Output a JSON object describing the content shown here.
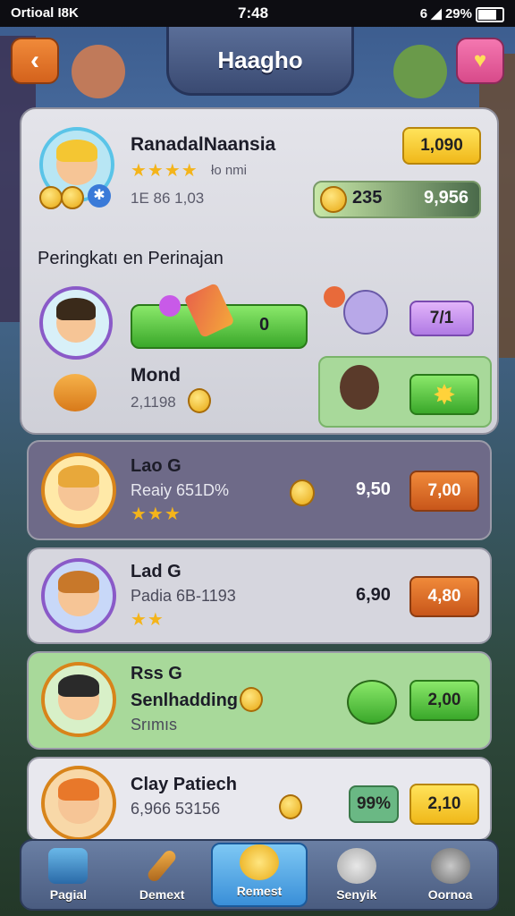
{
  "status_bar": {
    "left": "Ortioal I8K",
    "time": "7:48",
    "right": "6 ◢ 29%"
  },
  "header": {
    "title": "Haagho",
    "back_icon": "chevron-left-icon",
    "favorite_icon": "heart-icon"
  },
  "player": {
    "name": "RanadalNaansia",
    "stars_text": "★★★★",
    "rating_text": "ło nmi",
    "id_text": "1E 86 1,03",
    "gold_value": "1,090",
    "coin_value": "235",
    "total_value": "9,956"
  },
  "section": {
    "title": "Peringkatı en Perinajan"
  },
  "match": {
    "progress_value": "0",
    "badge_value": "7/1",
    "opponent_name": "Mond",
    "opponent_sub": "2,1198"
  },
  "leaderboard": [
    {
      "name": "Lao G",
      "sub": "Reaiy 651D%",
      "stars": "★★★",
      "score": "9,50",
      "button": "7,00",
      "bg": "#6e6a88"
    },
    {
      "name": "Lad G",
      "sub": "Padia 6B-1193",
      "stars": "★★",
      "score": "6,90",
      "button": "4,80",
      "bg": "#d6d6de"
    },
    {
      "name": "Rss G",
      "sub": "Senlhadding",
      "sub2": "Srımıs",
      "button": "2,00",
      "bg": "#a8d99a"
    },
    {
      "name": "Clay Patiech",
      "sub": "6,966 53156",
      "score": "99%",
      "button": "2,10",
      "bg": "#e8e8ee"
    }
  ],
  "nav": [
    {
      "label": "Pagial",
      "icon": "backpack-icon"
    },
    {
      "label": "Demext",
      "icon": "wand-icon"
    },
    {
      "label": "Remest",
      "icon": "compass-icon"
    },
    {
      "label": "Senyik",
      "icon": "character-icon"
    },
    {
      "label": "Oornoa",
      "icon": "helmet-icon"
    }
  ],
  "colors": {
    "accent_orange": "#e0742a",
    "accent_green": "#6ad04a",
    "accent_yellow": "#ffd23a",
    "accent_purple": "#c98ef2"
  }
}
